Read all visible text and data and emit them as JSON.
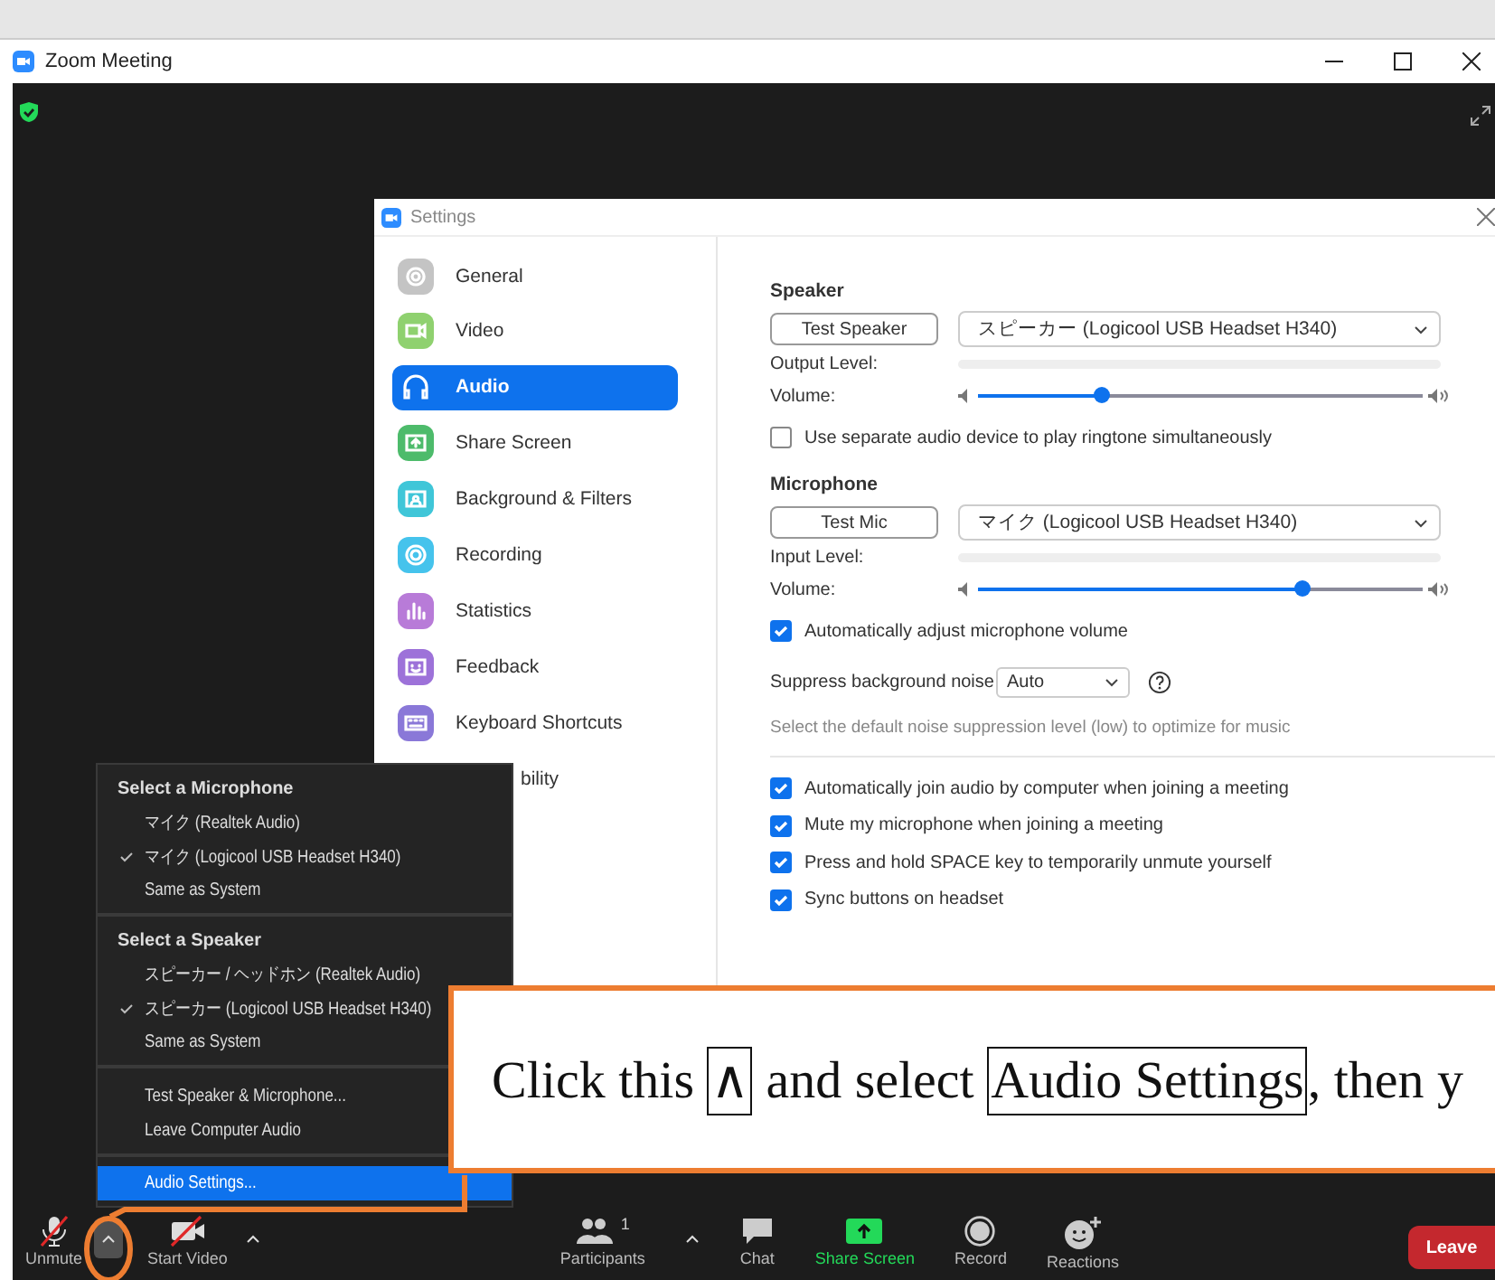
{
  "window": {
    "title": "Zoom Meeting"
  },
  "settings": {
    "title": "Settings",
    "sidebar": [
      {
        "label": "General",
        "kind": "gear",
        "color": "#c4c4c4",
        "selected": false
      },
      {
        "label": "Video",
        "kind": "camera",
        "color": "#8fd16f",
        "selected": false
      },
      {
        "label": "Audio",
        "kind": "headphones",
        "color": "#0e72ed",
        "selected": true
      },
      {
        "label": "Share Screen",
        "kind": "share",
        "color": "#4dbb6b",
        "selected": false
      },
      {
        "label": "Background & Filters",
        "kind": "person",
        "color": "#3fc6d8",
        "selected": false
      },
      {
        "label": "Recording",
        "kind": "record",
        "color": "#45c3ec",
        "selected": false
      },
      {
        "label": "Statistics",
        "kind": "bars",
        "color": "#b87bd8",
        "selected": false
      },
      {
        "label": "Feedback",
        "kind": "smile",
        "color": "#9d72d9",
        "selected": false
      },
      {
        "label": "Keyboard Shortcuts",
        "kind": "keyboard",
        "color": "#8a78d8",
        "selected": false
      },
      {
        "label": "bility",
        "kind": "hidden",
        "selected": false
      }
    ],
    "speaker": {
      "heading": "Speaker",
      "test_button": "Test Speaker",
      "device": "スピーカー (Logicool USB Headset H340)",
      "level_label": "Output Level:",
      "volume_label": "Volume:",
      "volume": {
        "level": 0.28
      }
    },
    "ringtone": {
      "label": "Use separate audio device to play ringtone simultaneously",
      "checked": false
    },
    "microphone": {
      "heading": "Microphone",
      "test_button": "Test Mic",
      "device": "マイク (Logicool USB Headset H340)",
      "level_label": "Input Level:",
      "volume_label": "Volume:",
      "volume": {
        "level": 0.73
      }
    },
    "auto_adjust": {
      "label": "Automatically adjust microphone volume",
      "checked": true
    },
    "suppress": {
      "label": "Suppress background noise",
      "value": "Auto",
      "hint": "Select the default noise suppression level (low) to optimize for music"
    },
    "options": [
      {
        "label": "Automatically join audio by computer when joining a meeting",
        "checked": true
      },
      {
        "label": "Mute my microphone when joining a meeting",
        "checked": true
      },
      {
        "label": "Press and hold SPACE key to temporarily unmute yourself",
        "checked": true
      },
      {
        "label": "Sync buttons on headset",
        "checked": true
      }
    ]
  },
  "audio_menu": {
    "sections": [
      {
        "heading": "Select a Microphone",
        "items": [
          {
            "label": "マイク (Realtek Audio)",
            "checked": false
          },
          {
            "label": "マイク (Logicool USB Headset H340)",
            "checked": true
          },
          {
            "label": "Same as System",
            "checked": false
          }
        ]
      },
      {
        "heading": "Select a Speaker",
        "items": [
          {
            "label": "スピーカー / ヘッドホン (Realtek Audio)",
            "checked": false
          },
          {
            "label": "スピーカー (Logicool USB Headset H340)",
            "checked": true
          },
          {
            "label": "Same as System",
            "checked": false
          }
        ]
      }
    ],
    "actions": [
      {
        "label": "Test Speaker & Microphone...",
        "selected": false
      },
      {
        "label": "Leave Computer Audio",
        "selected": false
      }
    ],
    "settings_item": {
      "label": "Audio Settings...",
      "selected": true
    }
  },
  "toolbar": {
    "left": [
      {
        "label": "Unmute",
        "kind": "mic-off",
        "caret_highlighted": true
      },
      {
        "label": "Start Video",
        "kind": "video-off",
        "caret_highlighted": false
      }
    ],
    "center": [
      {
        "label": "Participants",
        "kind": "people",
        "count": "1",
        "caret_highlighted": false
      },
      {
        "label": "Chat",
        "kind": "chat"
      },
      {
        "label": "Share Screen",
        "kind": "share"
      },
      {
        "label": "Record",
        "kind": "record"
      },
      {
        "label": "Reactions",
        "kind": "smile"
      }
    ],
    "leave": "Leave"
  },
  "callout": {
    "parts": [
      {
        "text": "Click this ",
        "boxed": false
      },
      {
        "text": "∧",
        "boxed": true
      },
      {
        "text": " and select ",
        "boxed": false
      },
      {
        "text": "Audio Settings",
        "boxed": true
      },
      {
        "text": ", then y",
        "boxed": false
      }
    ]
  }
}
